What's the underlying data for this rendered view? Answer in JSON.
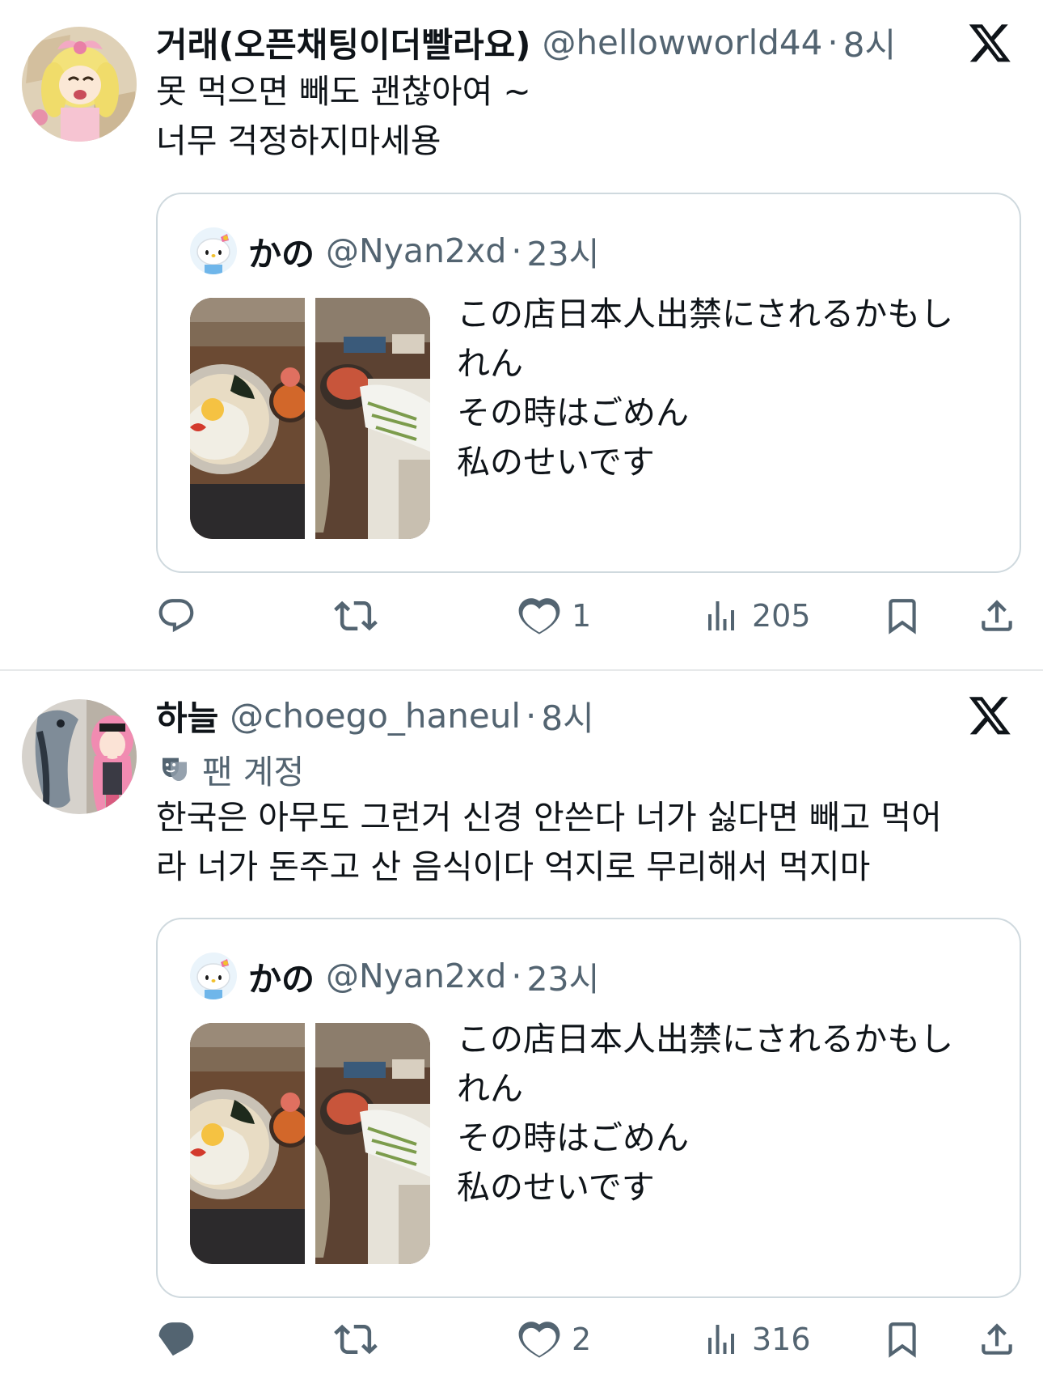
{
  "tweets": [
    {
      "author_name": "거래(오픈채팅이더빨라요)",
      "author_handle": "@hellowworld44",
      "separator": "·",
      "time": "8시",
      "body_lines": [
        "못 먹으면 빼도 괜찮아여 ~",
        "너무 걱정하지마세용"
      ],
      "quote": {
        "author_name": "かの",
        "author_handle": "@Nyan2xd",
        "separator": "·",
        "time": "23시",
        "text_lines": [
          "この店日本人出禁にされるかもし",
          "れん",
          "その時はごめん",
          "私のせいです"
        ]
      },
      "actions": {
        "replies": "",
        "reposts": "",
        "likes": "1",
        "views": "205"
      }
    },
    {
      "author_name": "하늘",
      "author_handle": "@choego_haneul",
      "separator": "·",
      "time": "8시",
      "fan_label": "팬 계정",
      "body_lines": [
        "한국은 아무도 그런거 신경 안쓴다 너가 싫다면 빼고 먹어",
        "라 너가 돈주고 산 음식이다 억지로 무리해서 먹지마"
      ],
      "quote": {
        "author_name": "かの",
        "author_handle": "@Nyan2xd",
        "separator": "·",
        "time": "23시",
        "text_lines": [
          "この店日本人出禁にされるかもし",
          "れん",
          "その時はごめん",
          "私のせいです"
        ]
      },
      "actions": {
        "replies": "",
        "reposts": "",
        "likes": "2",
        "views": "316"
      }
    }
  ],
  "colors": {
    "text_primary": "#0f1419",
    "text_secondary": "#536471",
    "border": "#cfd9de",
    "divider": "#e7e9ea"
  },
  "icons": {
    "reply": "reply-icon",
    "repost": "repost-icon",
    "like": "heart-icon",
    "views": "views-icon",
    "bookmark": "bookmark-icon",
    "share": "share-icon",
    "x_logo": "x-logo-icon",
    "fan_account": "theater-mask-icon"
  }
}
